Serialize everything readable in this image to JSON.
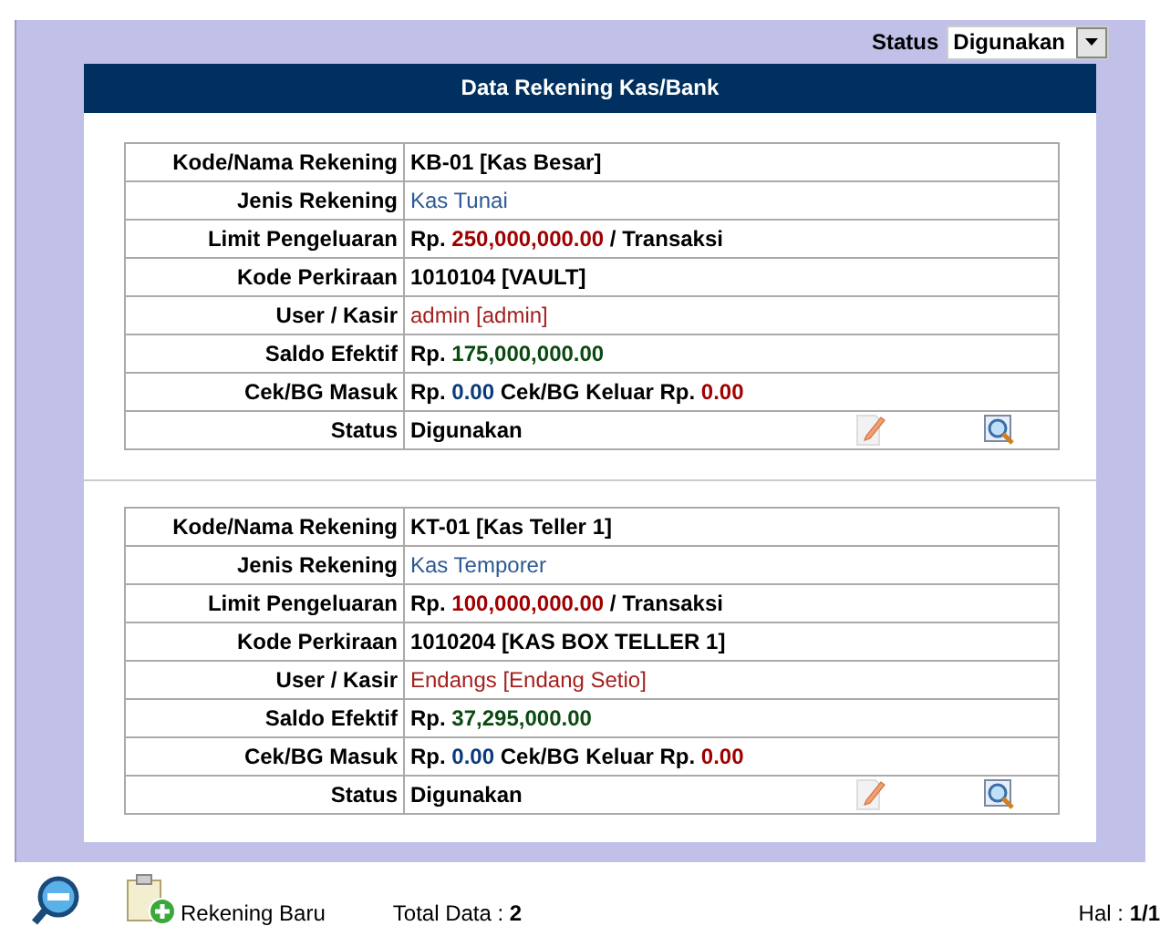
{
  "filter": {
    "label": "Status",
    "value": "Digunakan"
  },
  "panel": {
    "title": "Data Rekening Kas/Bank"
  },
  "accounts": [
    {
      "rows": [
        {
          "kind": "field",
          "label": "Kode/Nama Rekening",
          "parts": [
            {
              "kind": "bold",
              "text": "KB-01 [Kas Besar]"
            }
          ]
        },
        {
          "kind": "field",
          "label": "Jenis Rekening",
          "parts": [
            {
              "kind": "type",
              "text": "Kas Tunai"
            }
          ]
        },
        {
          "kind": "field",
          "label": "Limit Pengeluaran",
          "parts": [
            {
              "kind": "bold",
              "text": "Rp."
            },
            {
              "kind": "red",
              "text": "250,000,000.00"
            },
            {
              "kind": "bold",
              "text": "/ Transaksi"
            }
          ]
        },
        {
          "kind": "field",
          "label": "Kode Perkiraan",
          "parts": [
            {
              "kind": "bold",
              "text": "1010104 [VAULT]"
            }
          ]
        },
        {
          "kind": "field",
          "label": "User / Kasir",
          "parts": [
            {
              "kind": "user",
              "text": "admin [admin]"
            }
          ]
        },
        {
          "kind": "field",
          "label": "Saldo Efektif",
          "parts": [
            {
              "kind": "bold",
              "text": "Rp."
            },
            {
              "kind": "green",
              "text": "175,000,000.00"
            }
          ]
        },
        {
          "kind": "field",
          "label": "Cek/BG Masuk",
          "parts": [
            {
              "kind": "bold",
              "text": "Rp."
            },
            {
              "kind": "blue",
              "text": "0.00"
            },
            {
              "kind": "bold",
              "text": "Cek/BG Keluar Rp."
            },
            {
              "kind": "red",
              "text": "0.00"
            }
          ]
        },
        {
          "kind": "status",
          "label": "Status",
          "parts": [
            {
              "kind": "bold",
              "text": "Digunakan"
            }
          ]
        }
      ]
    },
    {
      "rows": [
        {
          "kind": "field",
          "label": "Kode/Nama Rekening",
          "parts": [
            {
              "kind": "bold",
              "text": "KT-01 [Kas Teller 1]"
            }
          ]
        },
        {
          "kind": "field",
          "label": "Jenis Rekening",
          "parts": [
            {
              "kind": "type",
              "text": "Kas Temporer"
            }
          ]
        },
        {
          "kind": "field",
          "label": "Limit Pengeluaran",
          "parts": [
            {
              "kind": "bold",
              "text": "Rp."
            },
            {
              "kind": "red",
              "text": "100,000,000.00"
            },
            {
              "kind": "bold",
              "text": "/ Transaksi"
            }
          ]
        },
        {
          "kind": "field",
          "label": "Kode Perkiraan",
          "parts": [
            {
              "kind": "bold",
              "text": "1010204 [KAS BOX TELLER 1]"
            }
          ]
        },
        {
          "kind": "field",
          "label": "User / Kasir",
          "parts": [
            {
              "kind": "user",
              "text": "Endangs [Endang Setio]"
            }
          ]
        },
        {
          "kind": "field",
          "label": "Saldo Efektif",
          "parts": [
            {
              "kind": "bold",
              "text": "Rp."
            },
            {
              "kind": "green",
              "text": "37,295,000.00"
            }
          ]
        },
        {
          "kind": "field",
          "label": "Cek/BG Masuk",
          "parts": [
            {
              "kind": "bold",
              "text": "Rp."
            },
            {
              "kind": "blue",
              "text": "0.00"
            },
            {
              "kind": "bold",
              "text": "Cek/BG Keluar Rp."
            },
            {
              "kind": "red",
              "text": "0.00"
            }
          ]
        },
        {
          "kind": "status",
          "label": "Status",
          "parts": [
            {
              "kind": "bold",
              "text": "Digunakan"
            }
          ]
        }
      ]
    }
  ],
  "footer": {
    "new_button": "Rekening Baru",
    "total": "Total Data : **2**",
    "page": "Hal : **1/1**"
  }
}
